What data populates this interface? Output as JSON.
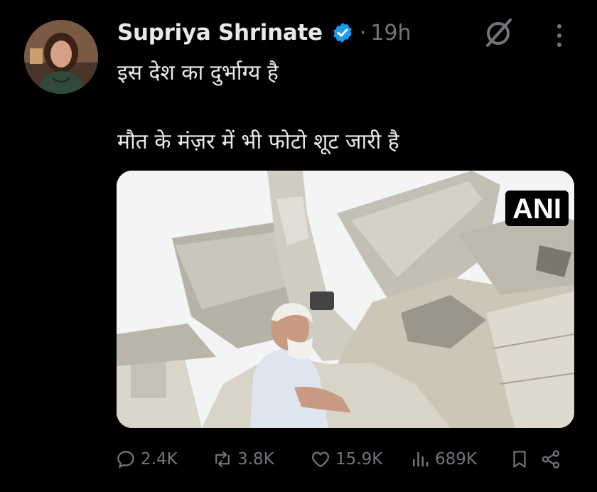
{
  "author": {
    "name": "Supriya Shrinate",
    "separator": "·",
    "time": "19h"
  },
  "tweet": {
    "line1": "इस देश का दुर्भाग्य है",
    "line2": "मौत के मंज़र में भी फोटो शूट जारी है"
  },
  "media": {
    "watermark": "ANI"
  },
  "actions": {
    "replies": "2.4K",
    "reposts": "3.8K",
    "likes": "15.9K",
    "views": "689K"
  },
  "colors": {
    "background": "#000000",
    "text": "#e7e9ea",
    "muted": "#71767b",
    "verified": "#1d9bf0"
  },
  "icons": [
    "verified-badge-icon",
    "grok-icon",
    "more-icon",
    "reply-icon",
    "repost-icon",
    "like-icon",
    "views-icon",
    "bookmark-icon",
    "share-icon"
  ]
}
